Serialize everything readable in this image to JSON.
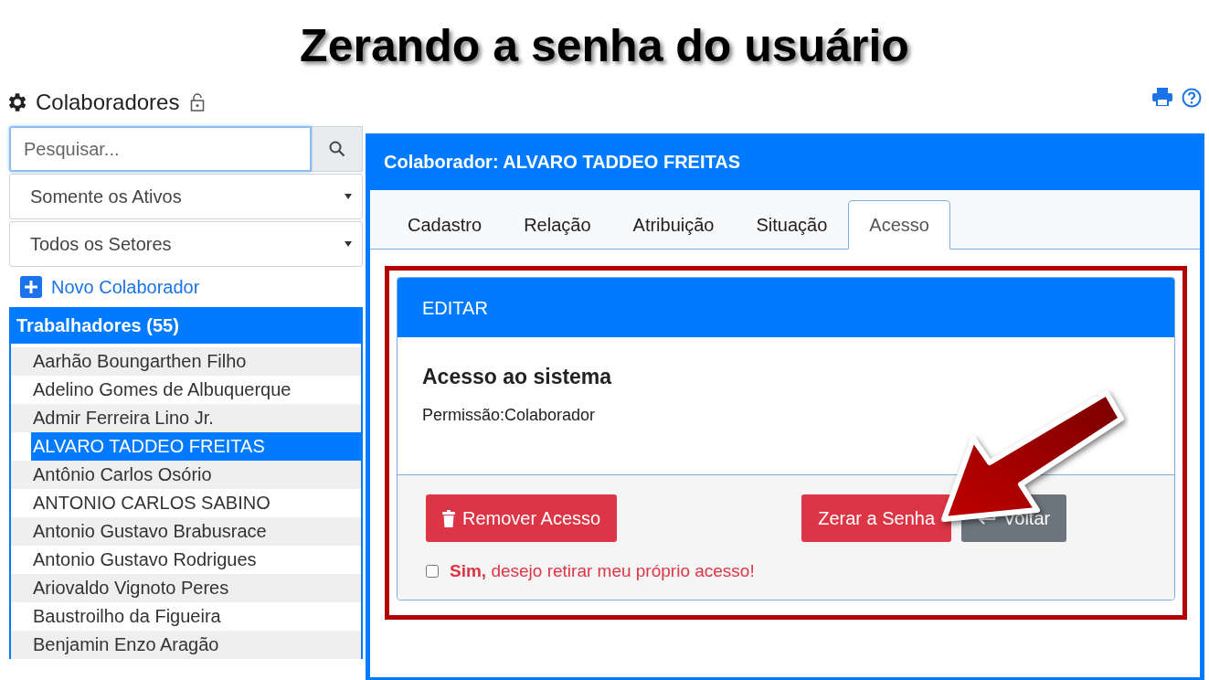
{
  "slide_title": "Zerando a senha do usuário",
  "page": {
    "title": "Colaboradores"
  },
  "search": {
    "placeholder": "Pesquisar..."
  },
  "filters": [
    {
      "value": "Somente os Ativos"
    },
    {
      "value": "Todos os Setores"
    }
  ],
  "new_link": "Novo Colaborador",
  "list": {
    "title": "Trabalhadores (55)",
    "items": [
      {
        "name": "Aarhão Boungarthen Filho",
        "selected": false
      },
      {
        "name": "Adelino Gomes de Albuquerque",
        "selected": false
      },
      {
        "name": "Admir Ferreira Lino Jr.",
        "selected": false
      },
      {
        "name": "ALVARO TADDEO FREITAS",
        "selected": true
      },
      {
        "name": "Antônio Carlos Osório",
        "selected": false
      },
      {
        "name": "ANTONIO CARLOS SABINO",
        "selected": false
      },
      {
        "name": "Antonio Gustavo Brabusrace",
        "selected": false
      },
      {
        "name": "Antonio Gustavo Rodrigues",
        "selected": false
      },
      {
        "name": "Ariovaldo Vignoto Peres",
        "selected": false
      },
      {
        "name": "Baustroilho da Figueira",
        "selected": false
      },
      {
        "name": "Benjamin Enzo Aragão",
        "selected": false
      }
    ]
  },
  "detail": {
    "title": "Colaborador: ALVARO TADDEO FREITAS",
    "tabs": [
      {
        "label": "Cadastro",
        "selected": false
      },
      {
        "label": "Relação",
        "selected": false
      },
      {
        "label": "Atribuição",
        "selected": false
      },
      {
        "label": "Situação",
        "selected": false
      },
      {
        "label": "Acesso",
        "selected": true
      }
    ],
    "card": {
      "header": "EDITAR",
      "heading": "Acesso ao sistema",
      "permission": "Permissão:Colaborador",
      "buttons": [
        {
          "label": "Remover Acesso",
          "kind": "remove"
        },
        {
          "label": "Zerar a Senha",
          "kind": "reset"
        },
        {
          "label": "Voltar",
          "kind": "back"
        }
      ],
      "confirm": {
        "text": "**Sim,** desejo retirar meu próprio acesso!",
        "checked": false
      }
    }
  }
}
